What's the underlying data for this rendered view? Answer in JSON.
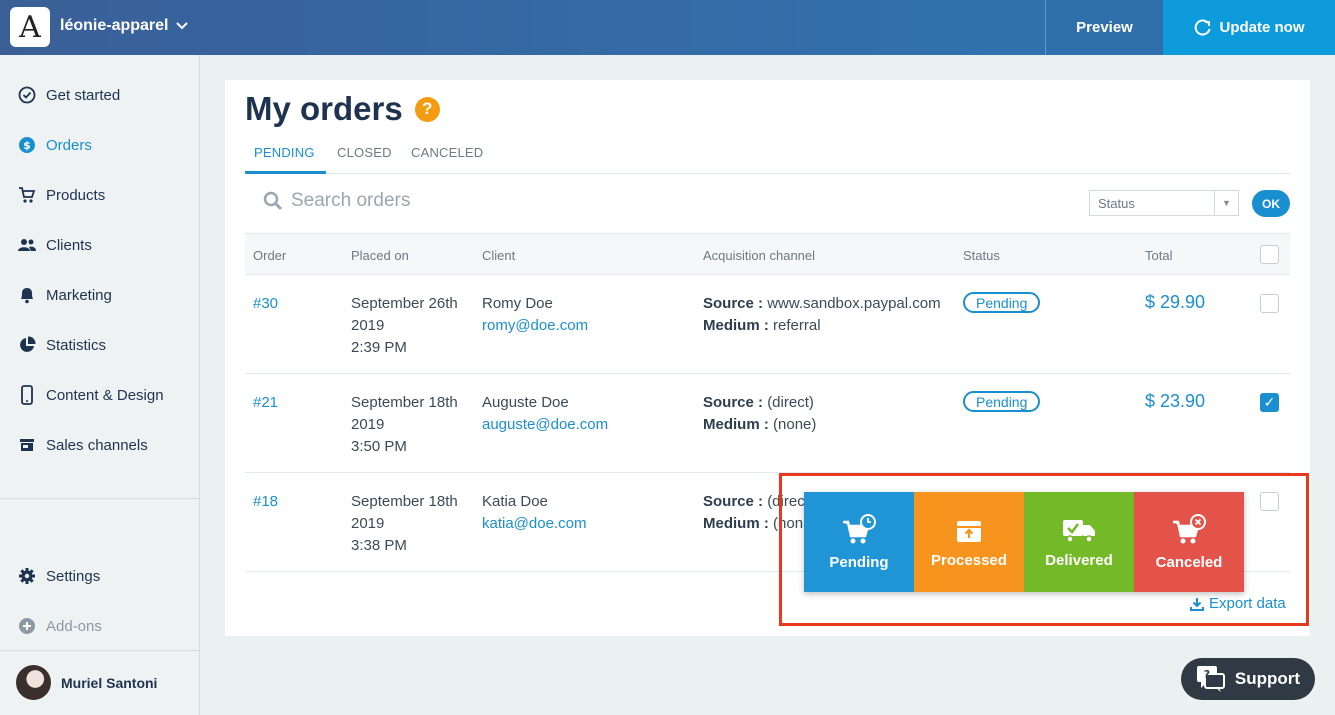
{
  "topbar": {
    "logo_letter": "A",
    "shop_name": "léonie-apparel",
    "preview_label": "Preview",
    "update_label": "Update now"
  },
  "sidebar": {
    "items": [
      {
        "label": "Get started",
        "icon": "check-circle-icon"
      },
      {
        "label": "Orders",
        "icon": "dollar-circle-icon",
        "active": true
      },
      {
        "label": "Products",
        "icon": "cart-icon"
      },
      {
        "label": "Clients",
        "icon": "people-icon"
      },
      {
        "label": "Marketing",
        "icon": "bell-icon"
      },
      {
        "label": "Statistics",
        "icon": "pie-chart-icon"
      },
      {
        "label": "Content & Design",
        "icon": "phone-icon"
      },
      {
        "label": "Sales channels",
        "icon": "store-icon"
      }
    ],
    "settings_label": "Settings",
    "addons_label": "Add-ons",
    "user_name": "Muriel Santoni"
  },
  "main": {
    "title": "My orders",
    "help": "?",
    "tabs": [
      {
        "label": "PENDING",
        "active": true
      },
      {
        "label": "CLOSED"
      },
      {
        "label": "CANCELED"
      }
    ],
    "search_placeholder": "Search orders",
    "status_select": "Status",
    "ok_label": "OK",
    "columns": [
      "Order",
      "Placed on",
      "Client",
      "Acquisition channel",
      "Status",
      "Total"
    ],
    "orders": [
      {
        "id": "#30",
        "date": "September 26th",
        "year": "2019",
        "time": "2:39 PM",
        "client": "Romy Doe",
        "email": "romy@doe.com",
        "source_label": "Source :",
        "source": "www.sandbox.paypal.com",
        "medium_label": "Medium :",
        "medium": "referral",
        "status": "Pending",
        "total": "$ 29.90",
        "checked": false
      },
      {
        "id": "#21",
        "date": "September 18th",
        "year": "2019",
        "time": "3:50 PM",
        "client": "Auguste Doe",
        "email": "auguste@doe.com",
        "source_label": "Source :",
        "source": "(direct)",
        "medium_label": "Medium :",
        "medium": "(none)",
        "status": "Pending",
        "total": "$ 23.90",
        "checked": true
      },
      {
        "id": "#18",
        "date": "September 18th",
        "year": "2019",
        "time": "3:38 PM",
        "client": "Katia Doe",
        "email": "katia@doe.com",
        "source_label": "Source :",
        "source": "(direc",
        "medium_label": "Medium :",
        "medium": "(non",
        "status": "",
        "total": "",
        "checked": false
      }
    ],
    "export_label": "Export data"
  },
  "actions": [
    {
      "label": "Pending",
      "icon": "cart-clock-icon",
      "color": "#1f95d6"
    },
    {
      "label": "Processed",
      "icon": "box-upload-icon",
      "color": "#f7941d"
    },
    {
      "label": "Delivered",
      "icon": "truck-check-icon",
      "color": "#73b928"
    },
    {
      "label": "Canceled",
      "icon": "cart-x-icon",
      "color": "#e3534a"
    }
  ],
  "support_label": "Support",
  "colors": {
    "accent": "#1a8fd0",
    "highlight": "#e8391f",
    "topbar": "#3a5f97"
  }
}
